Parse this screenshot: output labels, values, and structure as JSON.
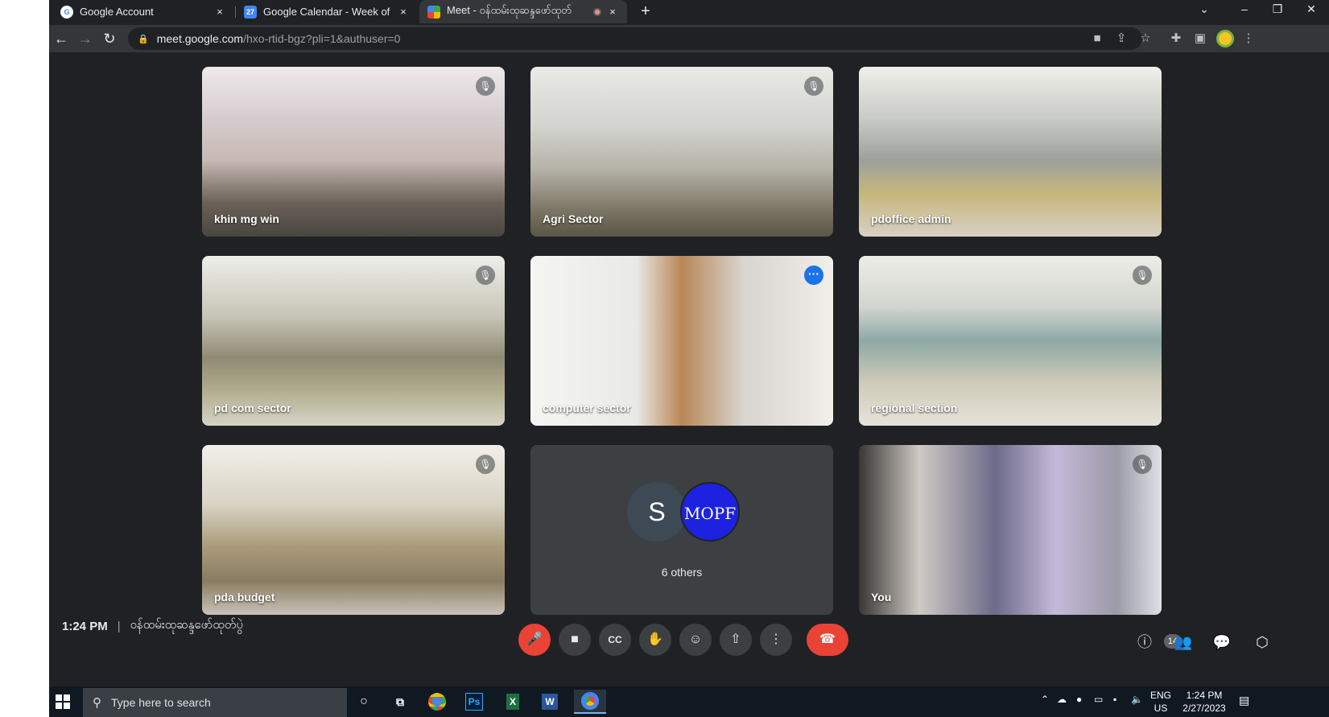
{
  "browser": {
    "tabs": [
      {
        "title": "Google Account",
        "icon": "google-g-icon",
        "close": "×"
      },
      {
        "title": "Google Calendar - Week of Febr",
        "icon": "calendar-icon",
        "close": "×"
      },
      {
        "title": "Meet - ဝန်ထမ်းထုဆန္ဒဖော်ထုတ်",
        "icon": "meet-icon",
        "close": "×",
        "recording": true
      }
    ],
    "new_tab": "+",
    "window_controls": {
      "menu": "⌄",
      "minimize": "–",
      "restore": "❐",
      "close": "✕"
    },
    "url_host": "meet.google.com",
    "url_path": "/hxo-rtid-bgz?pli=1&authuser=0"
  },
  "participants": [
    {
      "name": "khin mg win",
      "mic_icon": "mic-off-icon"
    },
    {
      "name": "Agri Sector",
      "mic_icon": "mic-off-icon"
    },
    {
      "name": "pdoffice admin",
      "mic_icon": ""
    },
    {
      "name": "pd com sector",
      "mic_icon": "mic-off-icon"
    },
    {
      "name": "computer sector",
      "mic_icon": "more-options-icon",
      "speaking": true
    },
    {
      "name": "regional section",
      "mic_icon": "mic-off-icon"
    },
    {
      "name": "pda budget",
      "mic_icon": "mic-off-icon"
    },
    {
      "name": "You",
      "mic_icon": "mic-off-icon"
    }
  ],
  "others_tile": {
    "avatar_letter": "S",
    "logo_text": "MOPF",
    "label": "6 others"
  },
  "meeting": {
    "time": "1:24 PM",
    "separator": "|",
    "name": "ဝန်ထမ်းထုဆန္ဒဖော်ထုတ်ပွဲ"
  },
  "controls": [
    "mic-off-icon",
    "camera-icon",
    "captions-icon",
    "raise-hand-icon",
    "emoji-icon",
    "present-icon",
    "more-options-icon",
    "hang-up-icon"
  ],
  "right_controls": {
    "info": "info-icon",
    "people": "people-icon",
    "people_count": "14",
    "chat": "chat-icon",
    "activities": "activities-icon"
  },
  "taskbar": {
    "search_placeholder": "Type here to search",
    "lang_top": "ENG",
    "lang_bottom": "US",
    "time": "1:24 PM",
    "date": "2/27/2023"
  },
  "colors": {
    "meet_bg": "#202124",
    "end_call": "#ea4335",
    "active_speaker": "#8ab4f8",
    "mopf_blue": "#1d22e0"
  }
}
